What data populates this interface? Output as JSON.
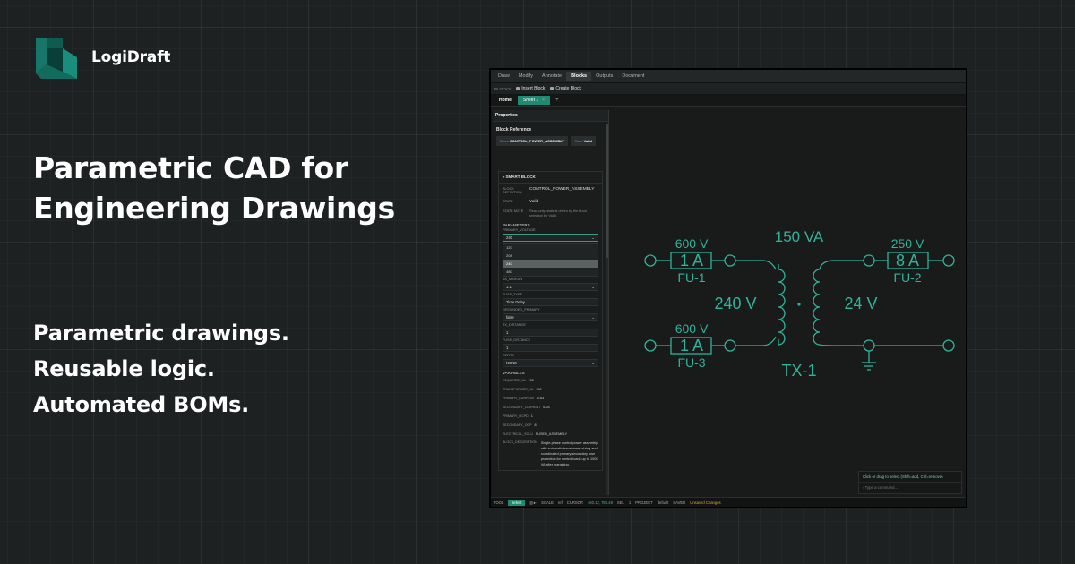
{
  "brand": {
    "name": "LogiDraft",
    "logo_color": "#17766a"
  },
  "headline": {
    "line1": "Parametric CAD for",
    "line2": "Engineering Drawings"
  },
  "taglines": [
    "Parametric drawings.",
    "Reusable logic.",
    "Automated BOMs."
  ],
  "app": {
    "menu": [
      "Draw",
      "Modify",
      "Annotate",
      "Blocks",
      "Outputs",
      "Document"
    ],
    "active_menu": "Blocks",
    "toolbar": {
      "label": "BLOCKS",
      "insert": "Insert Block",
      "create": "Create Block"
    },
    "tabs": {
      "home": "Home",
      "sheet": "Sheet 1",
      "close": "×",
      "add": "+"
    },
    "properties": {
      "title": "Properties",
      "section": "Block Reference",
      "block_key": "Block",
      "block_value": "CONTROL_POWER_ASSEMBLY",
      "state_key": "State",
      "state_value": "Valid",
      "smart_block": "▸ SMART BLOCK",
      "block_def_key": "BLOCK DEFINITION",
      "block_def_value": "CONTROL_POWER_ASSEMBLY",
      "state_key2": "STATE",
      "state_value2": "Valid",
      "state_note_key": "STATE NOTE",
      "state_note_value": "Read-only: state is driven by the block selection for Valid.",
      "parameters": "PARAMETERS",
      "primary_voltage": "PRIMARY_VOLTAGE",
      "primary_voltage_value": "240",
      "voltage_options": [
        "120",
        "208",
        "240",
        "480"
      ],
      "selected_option_index": 2,
      "va_margin": "VA_MARGIN",
      "va_margin_value": "1.1",
      "fuse_type": "FUSE_TYPE",
      "fuse_type_value": "Time Delay",
      "grounded_primary": "GROUNDED_PRIMARY",
      "grounded_primary_value": "false",
      "tx_distance": "TX_DISTANCE",
      "tx_distance_value": "1",
      "fuse_distance": "FUSE_DISTANCE",
      "fuse_distance_value": "1",
      "certs": "CERTS",
      "certs_value": "NONE",
      "variables": "VARIABLES",
      "vars": [
        {
          "k": "REQUIRED_VA",
          "v": "150"
        },
        {
          "k": "TRANSFORMER_VA",
          "v": "150"
        },
        {
          "k": "PRIMARY_CURRENT",
          "v": "0.63"
        },
        {
          "k": "SECONDARY_CURRENT",
          "v": "6.25"
        },
        {
          "k": "PRIMARY_OCPD",
          "v": "1"
        },
        {
          "k": "SECONDARY_OCP",
          "v": "8"
        },
        {
          "k": "ELECTRICAL_SOLU",
          "v": "FUSED_ASSEMBLY"
        }
      ],
      "desc_key": "BLOCK_DESCRIPTION",
      "desc_value": "Single-phase control power assembly with automatic transformer sizing and coordinated primary/secondary fuse protection for control loads up to 1000 VA after margining."
    },
    "schematic": {
      "fu1_volt": "600 V",
      "fu1_amp": "1 A",
      "fu1_name": "FU-1",
      "fu2_volt": "250 V",
      "fu2_amp": "8 A",
      "fu2_name": "FU-2",
      "fu3_volt": "600 V",
      "fu3_amp": "1 A",
      "fu3_name": "FU-3",
      "tx_va": "150 VA",
      "tx_primary": "240 V",
      "tx_secondary": "24 V",
      "tx_name": "TX-1",
      "color": "#2fb39a"
    },
    "console": {
      "hint": "Click or drag to select (Shift=add, Ctrl=remove)",
      "prompt": "›",
      "placeholder": "Type a command..."
    },
    "status": {
      "tool_label": "TOOL",
      "tool_value": "select",
      "scale_label": "SCALE",
      "scale_value": "ref",
      "cursor_label": "CURSOR",
      "cursor_value": "460.12, 785.48",
      "sel_label": "SEL",
      "sel_value": "1",
      "project_label": "PROJECT",
      "project_value": "default",
      "saved_label": "SAVED",
      "saved_value": "Unsaved Changes"
    }
  }
}
